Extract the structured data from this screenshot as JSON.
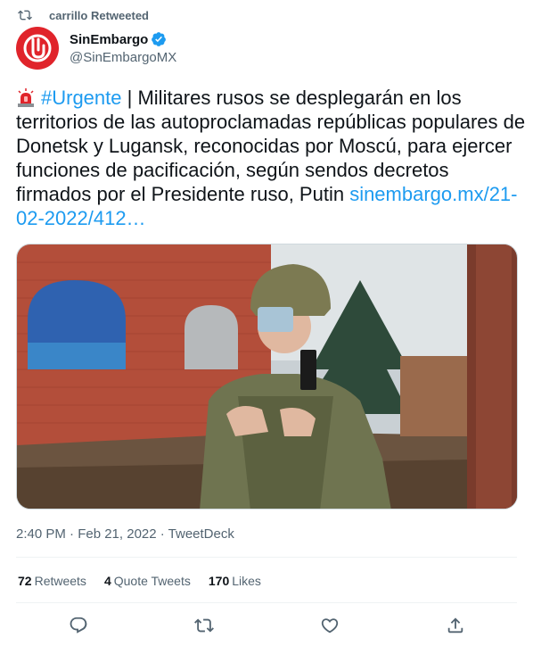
{
  "retweet_banner": {
    "text": "carrillo Retweeted"
  },
  "author": {
    "display_name": "SinEmbargo",
    "handle": "@SinEmbargoMX",
    "verified": true
  },
  "tweet": {
    "hashtag": "#Urgente",
    "separator": " | ",
    "body": "Militares rusos se desplegarán en los territorios de las autoproclamadas repúblicas populares de Donetsk y Lugansk, reconocidas por Moscú, para ejercer funciones de pacificación, según sendos decretos firmados por el Presidente ruso, Putin ",
    "link": "sinembargo.mx/21-02-2022/412…"
  },
  "meta": {
    "timestamp": "2:40 PM · Feb 21, 2022 · TweetDeck"
  },
  "stats": {
    "retweets_count": "72",
    "retweets_label": "Retweets",
    "quotes_count": "4",
    "quotes_label": "Quote Tweets",
    "likes_count": "170",
    "likes_label": "Likes"
  },
  "colors": {
    "link": "#1d9bf0",
    "secondary_text": "#536471",
    "brand_red": "#e0242b"
  },
  "icons": [
    "retweet-icon",
    "verified-badge-icon",
    "siren-icon",
    "reply-icon",
    "like-icon",
    "share-icon"
  ]
}
